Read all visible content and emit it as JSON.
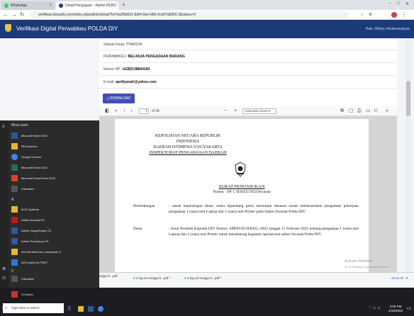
{
  "browser": {
    "tabs": [
      {
        "title": "WhatsApp",
        "color": "#25d366"
      },
      {
        "title": "Detail Pengajuan - Admin PERO",
        "color": "#1b3a7a"
      }
    ],
    "new_tab": "+",
    "url": "verifikasi.itwasdiy.com/index.php/admin/detail?id=0a2f6b0d1 &tbl=1&c=d6b-0ce87a82b5 2&status=2",
    "window_controls": [
      "–",
      "□",
      "✕"
    ]
  },
  "app": {
    "title": "Verifikasi Digital Perwabkeu POLDA DIY",
    "user": "Halo, Wahyu Wulanningtyas"
  },
  "detail": {
    "satker": "Satuan Kerja: ITWASDA",
    "perwabkeu_label": "PERWABKEU:",
    "perwabkeu_value": "BELANJA PENGADAAN BARANG",
    "phone_label": "Nomor HP:",
    "phone_value": "+6282138844169",
    "email_label": "E-mail:",
    "email_value": "aprillyanah@yahoo.com",
    "download": "⤓ DOWNLOAD"
  },
  "pdf": {
    "page_input": "1",
    "page_total": "of 36",
    "zoom_minus": "−",
    "zoom_plus": "+",
    "zoom": "Automatic Zoom",
    "doc": {
      "header1": "KEPOLISIAN NEGARA REPUBLIK INDONESIA",
      "header2": "DAERAH ISTIMEWA YOGYAKARTA",
      "header3": "INSPEKTORAT PENGAWASAN DAERAH",
      "title": "SURAT PENUNJUKAN",
      "number": "Nomor : SP/ (    /II/KEU/2022/Itwasda",
      "pertimbangan_label": "Pertimbangan",
      "pertimbangan_text": ": untuk kepentingan dinas, maka dipandang perlu menunjuk rekanan untuk melaksanakan pengadaan pekerjaan pengadaan 1 (satu) unit Laptop dan 1 (satu) unit Printer pada Satker Itwasda Polda DIY.",
      "dasar_label": "Dasar",
      "dasar_text": ": Surat Perintah Kapolda DIY Nomor: SPRIN/05/II/KEU./2022 tanggal 15 Februari 2022 tentang pengadaan 1 (satu) unit Laptop dan 1 (satu) unit Printer untuk mendukung kegiatan operasional satker Itwasda Polda DIY."
    }
  },
  "downloads": {
    "items": [
      "file-1-nomo....pdf",
      "3 log sct rengya k...pdf",
      "3 log sct rengya k...pdf",
      "3 log sct rengya k...pdf"
    ],
    "sub": "Selesai",
    "show_all": "Show all",
    "close": "✕"
  },
  "watermark": {
    "line1": "Activate Windows",
    "line2": "Go to Settings to activate Windows."
  },
  "start_menu": {
    "recent_header": "Most used",
    "items": [
      "Microsoft Word 2010",
      "File Explorer",
      "Google Chrome",
      "Microsoft Excel 2010",
      "Microsoft PowerPoint 2010",
      "Calculator"
    ],
    "section_a": "A",
    "a_items": [
      "ACD Systems",
      "Adobe Acrobat DC",
      "Adobe ImageReady CS",
      "Adobe Photoshop CS",
      "ArcSoft WebCam Companion 3",
      "AVG AntiVirus FREE"
    ],
    "section_c": "C",
    "c_items": [
      "Calculator",
      "CCleaner",
      "Compatibility Pack for the 2007 Office system"
    ]
  },
  "taskbar": {
    "search": "Type here to search",
    "time": "2:00 PM",
    "date": "4/16/2022"
  }
}
